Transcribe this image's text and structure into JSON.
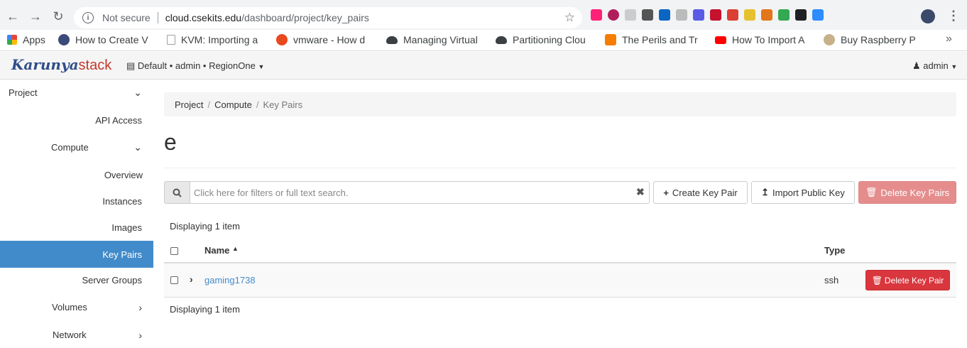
{
  "browser": {
    "security_label": "Not secure",
    "url_host": "cloud.csekits.edu",
    "url_path": "/dashboard/project/key_pairs"
  },
  "bookmarks": [
    {
      "label": "Apps",
      "color": "#ea4335"
    },
    {
      "label": "How to Create V",
      "color": "#3c4a7a"
    },
    {
      "label": "KVM: Importing a",
      "color": "#9aa0a6"
    },
    {
      "label": "vmware - How d",
      "color": "#e8491d"
    },
    {
      "label": "Managing Virtual",
      "color": "#3c4043"
    },
    {
      "label": "Partitioning Clou",
      "color": "#3c4043"
    },
    {
      "label": "The Perils and Tr",
      "color": "#f57d00"
    },
    {
      "label": "How To Import A",
      "color": "#ff0000"
    },
    {
      "label": "Buy Raspberry P",
      "color": "#c7b08a"
    }
  ],
  "navbar": {
    "brand_main": "Karunya",
    "brand_stack": "stack",
    "context": "Default • admin • RegionOne",
    "user": "admin"
  },
  "sidebar": {
    "project": "Project",
    "api_access": "API Access",
    "compute": "Compute",
    "overview": "Overview",
    "instances": "Instances",
    "images": "Images",
    "key_pairs": "Key Pairs",
    "server_groups": "Server Groups",
    "volumes": "Volumes",
    "network": "Network"
  },
  "breadcrumb": {
    "project": "Project",
    "compute": "Compute",
    "current": "Key Pairs"
  },
  "page_title": "e",
  "search": {
    "placeholder": "Click here for filters or full text search."
  },
  "actions": {
    "create": "Create Key Pair",
    "import": "Import Public Key",
    "delete": "Delete Key Pairs"
  },
  "table": {
    "displaying_top": "Displaying 1 item",
    "displaying_bottom": "Displaying 1 item",
    "col_name": "Name",
    "col_type": "Type",
    "rows": [
      {
        "name": "gaming1738",
        "type": "ssh",
        "action": "Delete Key Pair"
      }
    ]
  }
}
